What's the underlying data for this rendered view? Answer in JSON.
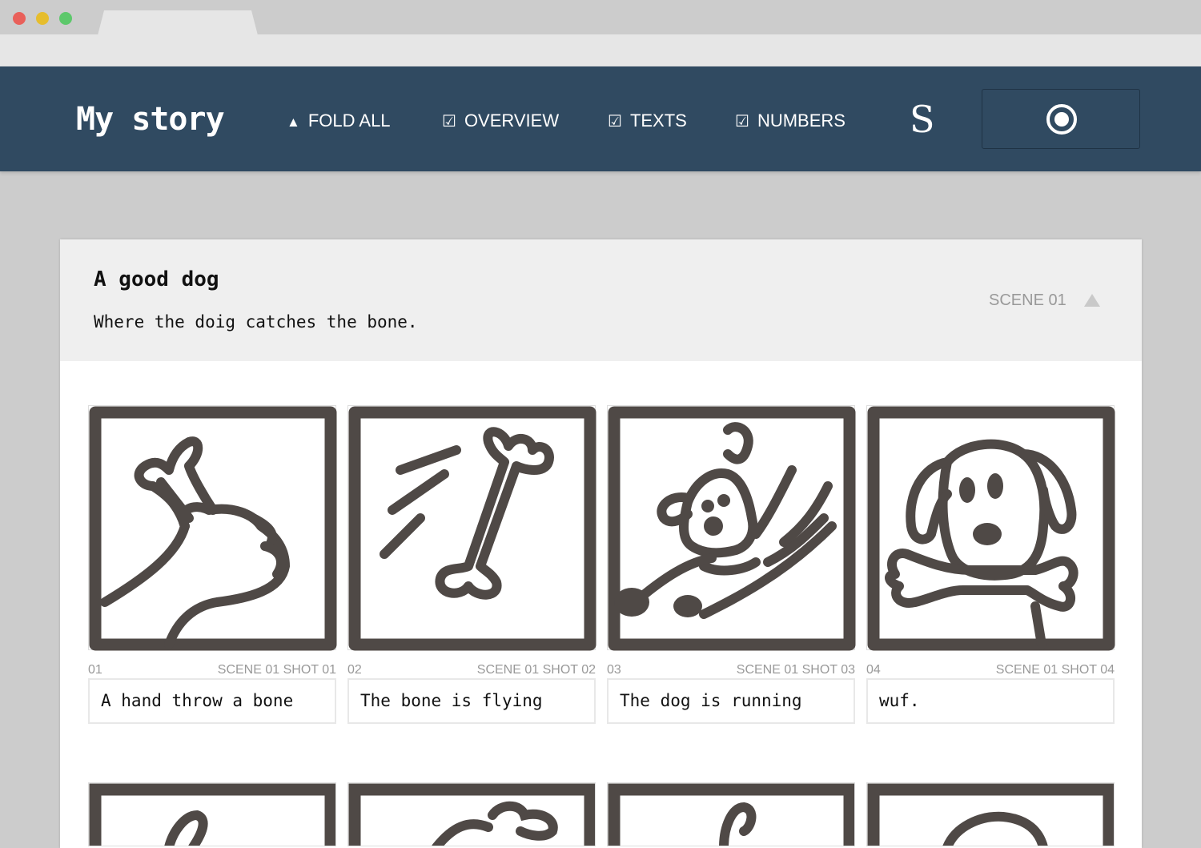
{
  "colors": {
    "appbar": "#304a61",
    "traffic_red": "#e9605a",
    "traffic_yellow": "#e6bd2d",
    "traffic_green": "#5dc86b",
    "ink": "#4f4946"
  },
  "app": {
    "title": "My story"
  },
  "toolbar": {
    "fold_all": {
      "icon": "triangle-up-icon",
      "glyph": "▲",
      "label": "FOLD ALL"
    },
    "overview": {
      "icon": "checkbox-icon",
      "glyph": "☑",
      "label": "OVERVIEW"
    },
    "texts": {
      "icon": "checkbox-icon",
      "glyph": "☑",
      "label": "TEXTS"
    },
    "numbers": {
      "icon": "checkbox-icon",
      "glyph": "☑",
      "label": "NUMBERS"
    },
    "logo": "S",
    "record_icon": "record-icon"
  },
  "scene": {
    "title": "A good dog",
    "description": "Where the doig catches the bone.",
    "label": "SCENE 01",
    "collapse_icon": "triangle-up-icon"
  },
  "shots": [
    {
      "num": "01",
      "label": "SCENE 01 SHOT 01",
      "caption": "A hand throw a bone",
      "drawing": "hand-with-bone"
    },
    {
      "num": "02",
      "label": "SCENE 01 SHOT 02",
      "caption": "The bone is flying",
      "drawing": "flying-bone"
    },
    {
      "num": "03",
      "label": "SCENE 01 SHOT 03",
      "caption": "The dog is running",
      "drawing": "running-dog"
    },
    {
      "num": "04",
      "label": "SCENE 01 SHOT 04",
      "caption": "wuf.",
      "drawing": "dog-with-bone"
    }
  ]
}
